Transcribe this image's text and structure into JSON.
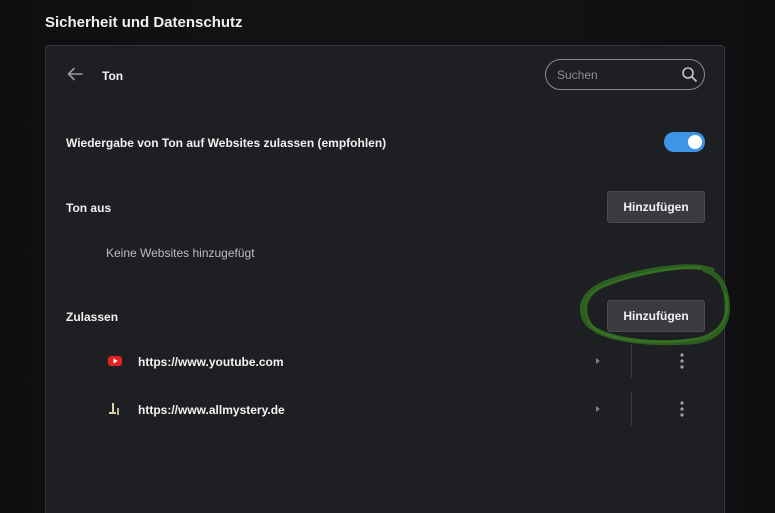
{
  "section_title": "Sicherheit und Datenschutz",
  "header": {
    "title": "Ton",
    "search_placeholder": "Suchen"
  },
  "allow_sound": {
    "label": "Wiedergabe von Ton auf Websites zulassen (empfohlen)",
    "enabled": true
  },
  "mute": {
    "label": "Ton aus",
    "add_button": "Hinzufügen",
    "empty_text": "Keine Websites hinzugefügt"
  },
  "allow": {
    "label": "Zulassen",
    "add_button": "Hinzufügen",
    "sites": [
      {
        "url": "https://www.youtube.com",
        "icon": "youtube-favicon"
      },
      {
        "url": "https://www.allmystery.de",
        "icon": "allmystery-favicon"
      }
    ]
  },
  "colors": {
    "accent": "#3d95e6",
    "annotation": "#2f6a1f",
    "youtube_red": "#e32222"
  }
}
